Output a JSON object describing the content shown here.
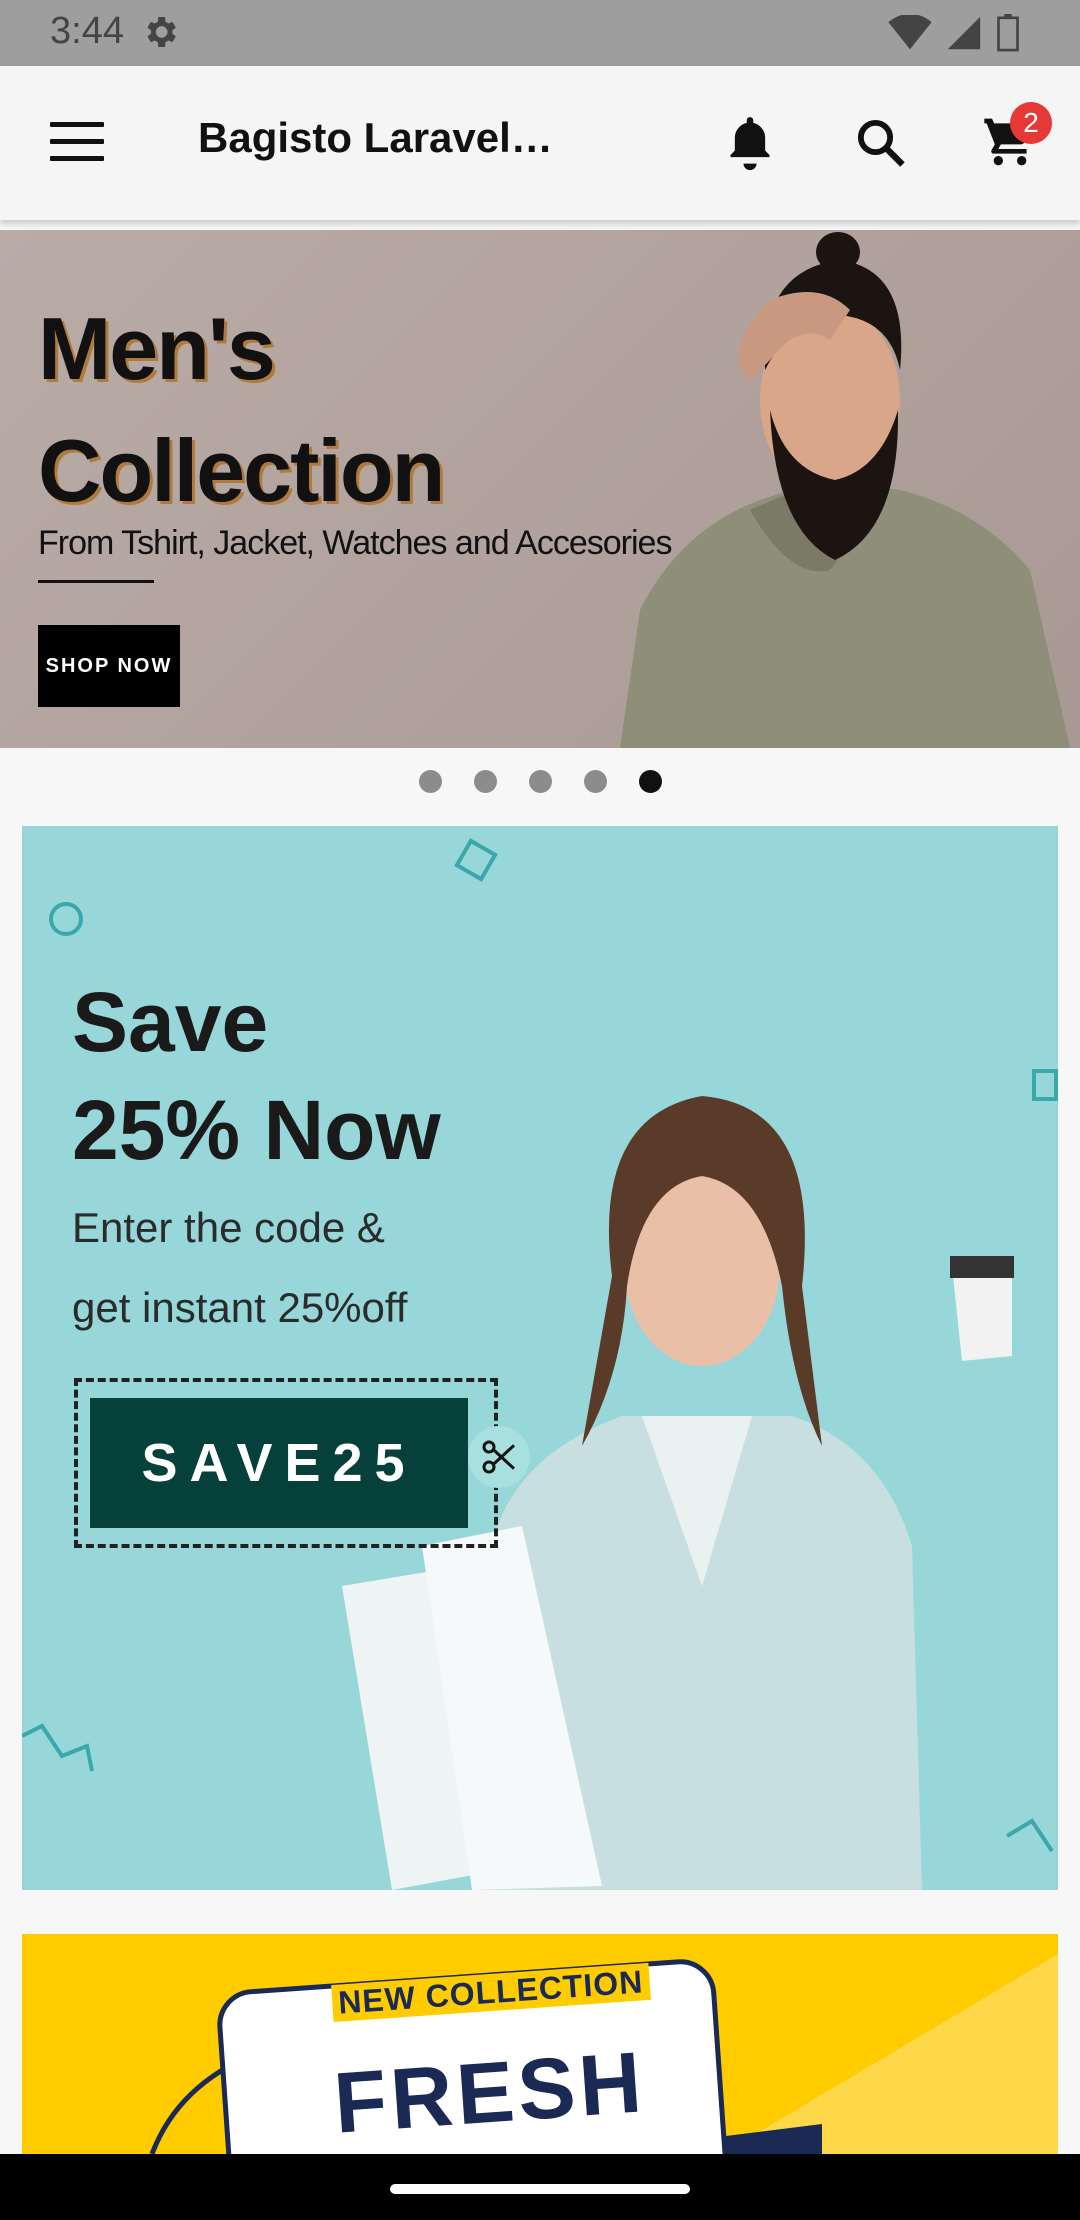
{
  "status_bar": {
    "time": "3:44"
  },
  "app_bar": {
    "title": "Bagisto Laravel …",
    "cart_count": "2"
  },
  "hero": {
    "title_line1": "Men's",
    "title_line2": "Collection",
    "subtitle": "From Tshirt, Jacket, Watches and Accesories",
    "cta_label": "SHOP NOW"
  },
  "carousel": {
    "total": 5,
    "active_index": 4
  },
  "promo": {
    "title_line1": "Save",
    "title_line2": "25% Now",
    "sub_line1": "Enter the code &",
    "sub_line2": "get instant 25%off",
    "coupon_code": "SAVE25"
  },
  "fresh_banner": {
    "kicker": "NEW COLLECTION",
    "headline": "FRESH"
  },
  "colors": {
    "app_bar_bg": "#f5f5f5",
    "badge": "#e53935",
    "promo_bg": "#97d7d9",
    "coupon_bg": "#06403a",
    "fresh_bg": "#ffcc00"
  }
}
